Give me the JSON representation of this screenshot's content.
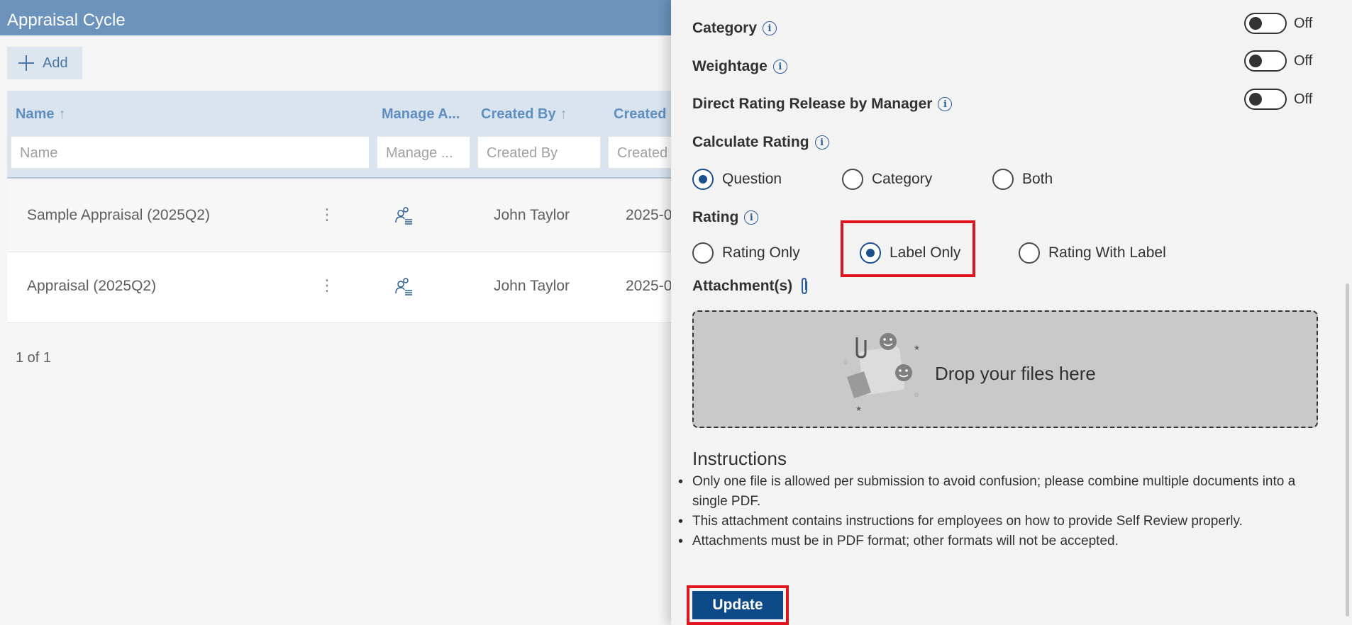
{
  "app": {
    "title": "Appraisal Cycle"
  },
  "toolbar": {
    "add_label": "Add"
  },
  "grid": {
    "columns": [
      {
        "label": "Name",
        "sort": "↑"
      },
      {
        "label": "Manage A...",
        "sort": ""
      },
      {
        "label": "Created By",
        "sort": "↑"
      },
      {
        "label": "Created",
        "sort": ""
      }
    ],
    "filters": [
      "Name",
      "Manage ...",
      "Created By",
      "Created"
    ],
    "rows": [
      {
        "name": "Sample Appraisal (2025Q2)",
        "created_by": "John Taylor",
        "created": "2025-0"
      },
      {
        "name": "Appraisal (2025Q2)",
        "created_by": "John Taylor",
        "created": "2025-0"
      }
    ],
    "row_menu_glyph": "⋮",
    "pager": "1 of 1"
  },
  "panel": {
    "toggles": [
      {
        "label": "Category",
        "state": "Off",
        "on": false
      },
      {
        "label": "Weightage",
        "state": "Off",
        "on": false
      },
      {
        "label": "Direct Rating Release by Manager",
        "state": "Off",
        "on": false
      }
    ],
    "calculate_rating": {
      "label": "Calculate Rating",
      "options": [
        "Question",
        "Category",
        "Both"
      ],
      "selected": "Question"
    },
    "rating": {
      "label": "Rating",
      "options": [
        "Rating Only",
        "Label Only",
        "Rating With Label"
      ],
      "selected": "Label Only"
    },
    "attachments": {
      "label": "Attachment(s)",
      "drop_text": "Drop your files here"
    },
    "instructions": {
      "title": "Instructions",
      "items": [
        "Only one file is allowed per submission to avoid confusion; please combine multiple documents into a single PDF.",
        "This attachment contains instructions for employees on how to provide Self Review properly.",
        "Attachments must be in PDF format; other formats will not be accepted."
      ]
    },
    "update_label": "Update"
  },
  "colors": {
    "header_bg": "#6b93bb",
    "accent": "#0f4a88",
    "highlight": "#e0141e"
  }
}
